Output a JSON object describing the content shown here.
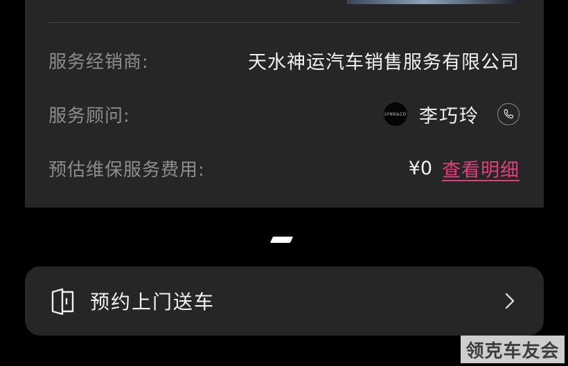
{
  "service_info": {
    "dealer": {
      "label": "服务经销商:",
      "value": "天水神运汽车销售服务有限公司"
    },
    "advisor": {
      "label": "服务顾问:",
      "name": "李巧玲",
      "avatar_text": "LYNK&CO"
    },
    "fee": {
      "label": "预估维保服务费用:",
      "amount": "¥0",
      "detail_link": "查看明细"
    }
  },
  "pickup": {
    "label": "预约上门送车"
  },
  "watermark": {
    "text": "领克车友会"
  },
  "icons": {
    "phone": "phone-icon",
    "door": "door-icon",
    "chevron": "chevron-right-icon"
  },
  "colors": {
    "background": "#000000",
    "card": "#262626",
    "label": "#8d8d8d",
    "value": "#f2f2f2",
    "link": "#e0407e"
  }
}
